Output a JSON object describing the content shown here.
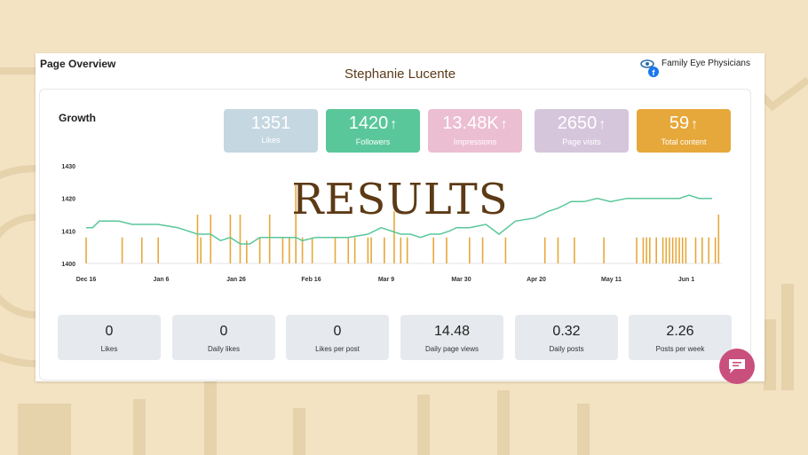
{
  "header": {
    "title": "Page Overview",
    "user_name": "Stephanie Lucente",
    "brand_name": "Family Eye Physicians"
  },
  "growth": {
    "title": "Growth"
  },
  "kpis": [
    {
      "value": "1351",
      "label": "Likes",
      "arrow": "",
      "color": "#c5d7e1"
    },
    {
      "value": "1420",
      "label": "Followers",
      "arrow": "↑",
      "color": "#59c79a"
    },
    {
      "value": "13.48K",
      "label": "Impressions",
      "arrow": "↑",
      "color": "#ecbed1"
    },
    {
      "value": "2650",
      "label": "Page visits",
      "arrow": "↑",
      "color": "#d5c6dc"
    },
    {
      "value": "59",
      "label": "Total content",
      "arrow": "↑",
      "color": "#e6a83a"
    }
  ],
  "overlay": {
    "text": "RESULTS"
  },
  "chart_data": {
    "type": "line",
    "x_tick_labels": [
      "Dec 16",
      "Jan 6",
      "Jan 26",
      "Feb 16",
      "Mar 9",
      "Mar 30",
      "Apr 20",
      "May 11",
      "Jun 1"
    ],
    "y_tick_labels": [
      "1400",
      "1410",
      "1420",
      "1430"
    ],
    "ylim": [
      1400,
      1430
    ],
    "grid": false,
    "series": [
      {
        "type": "line",
        "color": "#59c79a",
        "x": [
          0,
          2,
          4,
          10,
          14,
          17,
          22,
          28,
          34,
          38,
          41,
          44,
          47,
          50,
          53,
          56,
          60,
          64,
          66,
          70,
          75,
          80,
          86,
          90,
          96,
          99,
          102,
          105,
          108,
          111,
          113,
          117,
          122,
          126,
          131,
          137,
          141,
          144,
          148,
          152,
          156,
          160,
          165,
          170,
          175,
          178,
          181,
          184,
          187,
          191
        ],
        "values": [
          1411,
          1411,
          1413,
          1413,
          1412,
          1412,
          1412,
          1411,
          1409,
          1409,
          1407,
          1408,
          1406,
          1406,
          1408,
          1408,
          1408,
          1408,
          1407,
          1408,
          1408,
          1408,
          1409,
          1411,
          1409,
          1409,
          1408,
          1409,
          1409,
          1410,
          1411,
          1411,
          1412,
          1409,
          1413,
          1414,
          1416,
          1417,
          1419,
          1419,
          1420,
          1419,
          1420,
          1420,
          1420,
          1420,
          1420,
          1421,
          1420,
          1420
        ]
      },
      {
        "type": "bar",
        "color": "#e6a83a",
        "x": [
          0,
          11,
          17,
          22,
          34,
          35,
          38,
          44,
          47,
          49,
          53,
          56,
          60,
          62,
          64,
          66,
          69,
          76,
          80,
          82,
          86,
          87,
          91,
          94,
          96,
          98,
          106,
          110,
          117,
          121,
          128,
          140,
          144,
          149,
          158,
          168,
          170,
          171,
          172,
          174,
          176,
          177,
          178,
          179,
          180,
          181,
          182,
          183,
          186,
          188,
          190,
          192,
          193
        ],
        "values": [
          1408,
          1408,
          1408,
          1408,
          1415,
          1408,
          1415,
          1415,
          1415,
          1407,
          1408,
          1415,
          1408,
          1408,
          1424,
          1408,
          1408,
          1408,
          1408,
          1408,
          1408,
          1408,
          1408,
          1416,
          1408,
          1408,
          1408,
          1408,
          1408,
          1408,
          1408,
          1408,
          1408,
          1408,
          1408,
          1408,
          1408,
          1408,
          1408,
          1408,
          1408,
          1408,
          1408,
          1408,
          1408,
          1408,
          1408,
          1408,
          1408,
          1408,
          1408,
          1408,
          1415
        ]
      }
    ]
  },
  "stats": [
    {
      "value": "0",
      "label": "Likes"
    },
    {
      "value": "0",
      "label": "Daily likes"
    },
    {
      "value": "0",
      "label": "Likes per post"
    },
    {
      "value": "14.48",
      "label": "Daily page views"
    },
    {
      "value": "0.32",
      "label": "Daily posts"
    },
    {
      "value": "2.26",
      "label": "Posts per week"
    }
  ],
  "chat": {
    "icon": "chat-bubble-icon",
    "color": "#c94f7c"
  }
}
